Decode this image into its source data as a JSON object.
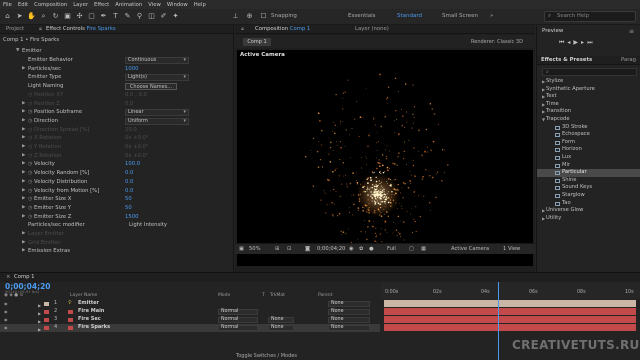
{
  "menubar": [
    "File",
    "Edit",
    "Composition",
    "Layer",
    "Effect",
    "Animation",
    "View",
    "Window",
    "Help"
  ],
  "toolbar": {
    "snapping": "Snapping",
    "workspaces": [
      "Essentials",
      "Standard",
      "Small Screen"
    ],
    "search_help": "Search Help"
  },
  "left_panel": {
    "tabs": [
      "Project",
      "Effect Controls",
      "Fire Sparks"
    ],
    "breadcrumb": "Comp 1 • Fire Sparks",
    "group": "Emitter",
    "rows": [
      {
        "label": "Emitter Behavior",
        "dropdown": "Continuous"
      },
      {
        "label": "Particles/sec",
        "value": "1000"
      },
      {
        "label": "Emitter Type",
        "dropdown": "Light(s)"
      },
      {
        "label": "Light Naming",
        "button": "Choose Names..."
      },
      {
        "label": "Position XY",
        "value": "0.0 , 0.0"
      },
      {
        "label": "Position Z",
        "value": "0.0"
      },
      {
        "label": "Position Subframe",
        "dropdown": "Linear"
      },
      {
        "label": "Direction",
        "dropdown": "Uniform"
      },
      {
        "label": "Direction Spread [%]",
        "value": "20.0"
      },
      {
        "label": "X Rotation",
        "value": "0x +0.0°"
      },
      {
        "label": "Y Rotation",
        "value": "0x +0.0°"
      },
      {
        "label": "Z Rotation",
        "value": "0x +0.0°"
      },
      {
        "label": "Velocity",
        "value": "100.0"
      },
      {
        "label": "Velocity Random [%]",
        "value": "0.0"
      },
      {
        "label": "Velocity Distribution",
        "value": "0.0"
      },
      {
        "label": "Velocity from Motion [%]",
        "value": "0.0"
      },
      {
        "label": "Emitter Size X",
        "value": "50"
      },
      {
        "label": "Emitter Size Y",
        "value": "50"
      },
      {
        "label": "Emitter Size Z",
        "value": "1500"
      },
      {
        "label": "Particles/sec modifier",
        "plain": "Light Intensity"
      },
      {
        "label": "Layer Emitter"
      },
      {
        "label": "Grid Emitter"
      },
      {
        "label": "Emission Extras"
      }
    ]
  },
  "viewer": {
    "tabs": [
      "Composition",
      "Comp 1",
      "Layer (none)"
    ],
    "comp_tab": "Comp 1",
    "renderer": "Renderer: Classic 3D",
    "active_camera_label": "Active Camera",
    "zoom": "50%",
    "timecode": "0;00;04;20",
    "resolution": "Full",
    "camera": "Active Camera",
    "views": "1 View"
  },
  "right_panel": {
    "preview": "Preview",
    "fx_tabs": [
      "Effects & Presets",
      "Parag"
    ],
    "fx_search": "",
    "items": [
      {
        "name": "Stylize",
        "child": false
      },
      {
        "name": "Synthetic Aperture",
        "child": false
      },
      {
        "name": "Text",
        "child": false
      },
      {
        "name": "Time",
        "child": false
      },
      {
        "name": "Transition",
        "child": false
      },
      {
        "name": "Trapcode",
        "child": false,
        "open": true
      },
      {
        "name": "3D Stroke",
        "child": true
      },
      {
        "name": "Echospace",
        "child": true
      },
      {
        "name": "Form",
        "child": true
      },
      {
        "name": "Horizon",
        "child": true
      },
      {
        "name": "Lux",
        "child": true
      },
      {
        "name": "Mir",
        "child": true
      },
      {
        "name": "Particular",
        "child": true,
        "selected": true
      },
      {
        "name": "Shine",
        "child": true
      },
      {
        "name": "Sound Keys",
        "child": true
      },
      {
        "name": "Starglow",
        "child": true
      },
      {
        "name": "Tao",
        "child": true
      },
      {
        "name": "Universe Glow",
        "child": false
      },
      {
        "name": "Utility",
        "child": false
      }
    ]
  },
  "timeline": {
    "tab": "Comp 1",
    "timecode": "0;00;04;20",
    "frames": "00140 (29.97 fps)",
    "headers": {
      "source": "Layer Name",
      "mode": "Mode",
      "t": "T",
      "trkmat": "TrkMat",
      "parent": "Parent"
    },
    "ruler": [
      "0:00s",
      "02s",
      "04s",
      "06s",
      "08s",
      "10s"
    ],
    "layers": [
      {
        "num": "1",
        "name": "Emitter",
        "mode": "",
        "trkmat": "",
        "parent": "None",
        "color": "#c9b6a5",
        "light": true
      },
      {
        "num": "2",
        "name": "Fire Main",
        "mode": "Normal",
        "trkmat": "",
        "parent": "None",
        "color": "#c24a4a"
      },
      {
        "num": "3",
        "name": "Fire Sec",
        "mode": "Normal",
        "trkmat": "None",
        "parent": "None",
        "color": "#c24a4a"
      },
      {
        "num": "4",
        "name": "Fire Sparks",
        "mode": "Normal",
        "trkmat": "None",
        "parent": "None",
        "color": "#c24a4a",
        "selected": true
      }
    ],
    "toggle_label": "Toggle Switches / Modes"
  },
  "watermark": "CREATIVETUTS.RU",
  "colors": {
    "accent": "#4a9bef",
    "layer_red": "#c24a4a",
    "emitter_bar": "#c9b6a5"
  }
}
